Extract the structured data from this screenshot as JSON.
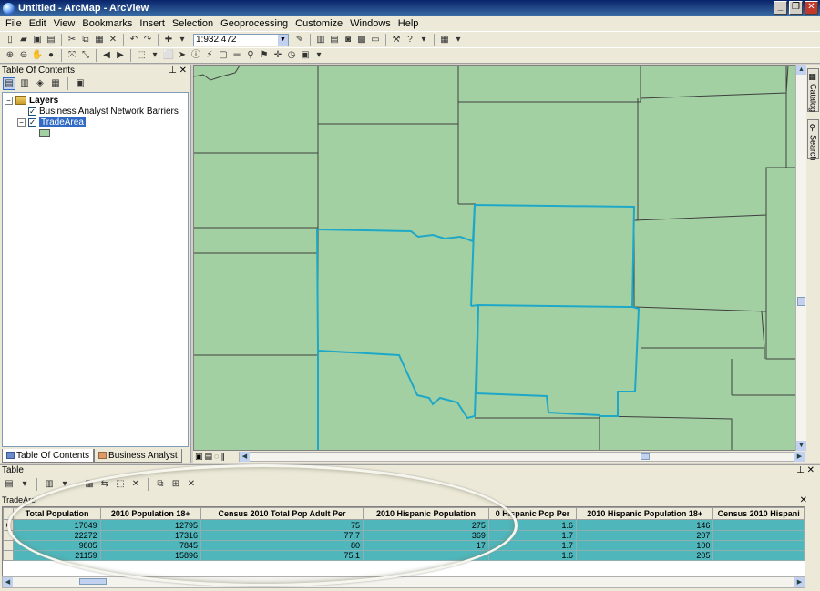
{
  "window": {
    "title": "Untitled - ArcMap - ArcView"
  },
  "menu": [
    "File",
    "Edit",
    "View",
    "Bookmarks",
    "Insert",
    "Selection",
    "Geoprocessing",
    "Customize",
    "Windows",
    "Help"
  ],
  "toolbar": {
    "scale": "1:932,472"
  },
  "toc": {
    "title": "Table Of Contents",
    "root": "Layers",
    "layers": [
      {
        "name": "Business Analyst Network Barriers",
        "checked": true
      },
      {
        "name": "TradeArea",
        "checked": true,
        "selected": true
      }
    ],
    "tabs": [
      "Table Of Contents",
      "Business Analyst"
    ]
  },
  "dock": {
    "tabs": [
      "Catalog",
      "Search"
    ]
  },
  "table": {
    "title": "Table",
    "tab_name": "TradeAre",
    "columns": [
      "Total Population",
      "2010 Population 18+",
      "Census 2010 Total Pop Adult Per",
      "2010 Hispanic Population",
      "0 Hispanic Pop Per",
      "2010 Hispanic Population 18+",
      "Census 2010 Hispani"
    ],
    "rows": [
      [
        "17049",
        "12795",
        "75",
        "275",
        "1.6",
        "146",
        ""
      ],
      [
        "22272",
        "17316",
        "77.7",
        "369",
        "1.7",
        "207",
        ""
      ],
      [
        "9805",
        "7845",
        "80",
        "17",
        "1.7",
        "100",
        ""
      ],
      [
        "21159",
        "15896",
        "75.1",
        "",
        "1.6",
        "205",
        ""
      ]
    ]
  },
  "colors": {
    "map_fill": "#a3d0a3",
    "trade_area_outline": "#1ea8c8",
    "selection_row": "#4fb6bb"
  }
}
